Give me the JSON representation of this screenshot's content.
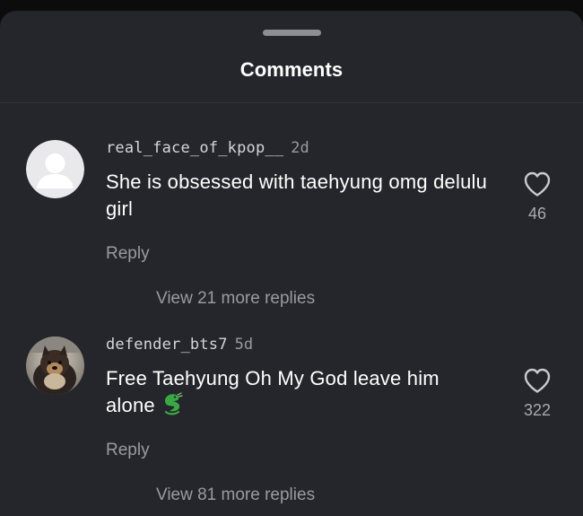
{
  "sheet": {
    "title": "Comments"
  },
  "comments": [
    {
      "username": "real_face_of_kpop__",
      "time": "2d",
      "text": "She is obsessed with taehyung omg delulu girl",
      "reply_label": "Reply",
      "view_replies_label": "View 21 more replies",
      "likes": "46",
      "avatar": "default-avatar-icon"
    },
    {
      "username": "defender_bts7",
      "time": "5d",
      "text": "Free Taehyung Oh My God leave him alone",
      "emoji": "dragon-emoji-icon",
      "reply_label": "Reply",
      "view_replies_label": "View 81 more replies",
      "likes": "322",
      "avatar": "dog-photo-avatar"
    }
  ],
  "colors": {
    "background": "#0c0c0d",
    "sheet": "#25262b",
    "primary_text": "#ffffff",
    "secondary_text": "#9a9ba0",
    "emoji_green": "#3aa845"
  }
}
